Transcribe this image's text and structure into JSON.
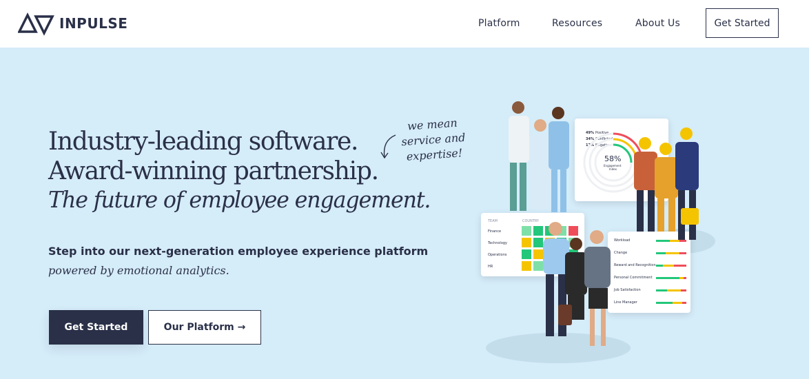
{
  "header": {
    "brand": "INPULSE",
    "nav": [
      {
        "label": "Platform"
      },
      {
        "label": "Resources"
      },
      {
        "label": "About Us"
      }
    ],
    "cta_label": "Get Started"
  },
  "hero": {
    "line1": "Industry-leading software.",
    "line2": "Award-winning partnership.",
    "line3": "The future of employee engagement.",
    "annotation": [
      "we mean",
      "service and",
      "expertise!"
    ],
    "subtitle": "Step into our next-generation employee experience platform",
    "subtitle_script": "powered by emotional analytics.",
    "primary_button": "Get Started",
    "secondary_button": "Our Platform →"
  },
  "illustration": {
    "gauge": {
      "stats": [
        {
          "pct": "49%",
          "label": "Positive"
        },
        {
          "pct": "34%",
          "label": "Conflicted"
        },
        {
          "pct": "17%",
          "label": "Negative"
        }
      ],
      "value": "58%",
      "caption_line1": "Engagement",
      "caption_line2": "Index"
    },
    "heatmap": {
      "col_team": "TEAM",
      "col_country": "COUNTRY",
      "rows": [
        "Finance",
        "Technology",
        "Operations",
        "HR"
      ]
    },
    "drivers": [
      "Workload",
      "Change",
      "Reward and Recognition",
      "Personal Commitment",
      "Job Satisfaction",
      "Line Manager"
    ]
  },
  "colors": {
    "navy": "#2a3048",
    "background": "#d5ecf9",
    "positive": "#22c77a",
    "conflicted": "#f5c400",
    "negative": "#ef4d5a"
  }
}
